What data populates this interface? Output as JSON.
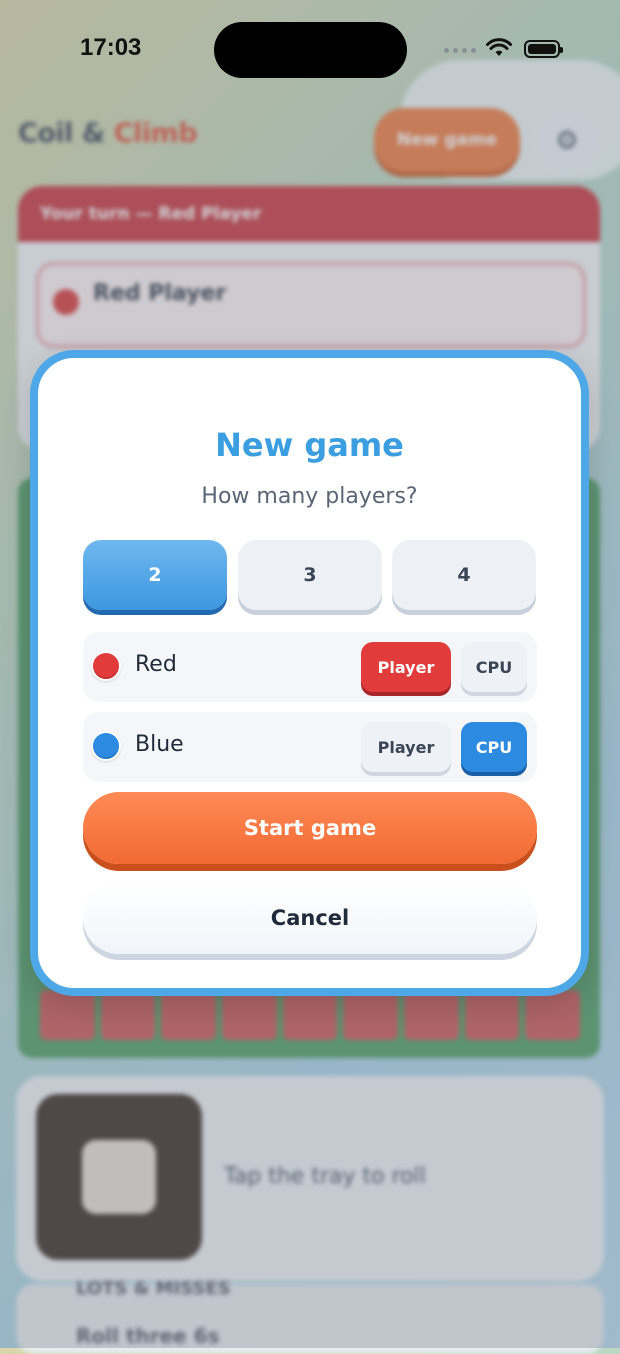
{
  "status_bar": {
    "time": "17:03"
  },
  "background_app": {
    "title_part1": "Coil & ",
    "title_part2": "Climb",
    "new_game_button": "New game",
    "turn_banner": "Your turn — Red Player",
    "current_player": "Red Player",
    "tray_hint": "Tap the tray to roll",
    "list_item_1": "LOTS & MISSES",
    "list_item_2": "Roll three 6s"
  },
  "modal": {
    "title": "New game",
    "subtitle": "How many players?",
    "player_counts": [
      "2",
      "3",
      "4"
    ],
    "selected_count": "2",
    "players": [
      {
        "name": "Red",
        "color": "#e23b3b",
        "player_label": "Player",
        "cpu_label": "CPU",
        "mode": "Player"
      },
      {
        "name": "Blue",
        "color": "#2c8be0",
        "player_label": "Player",
        "cpu_label": "CPU",
        "mode": "CPU"
      }
    ],
    "start_button": "Start game",
    "cancel_button": "Cancel"
  }
}
